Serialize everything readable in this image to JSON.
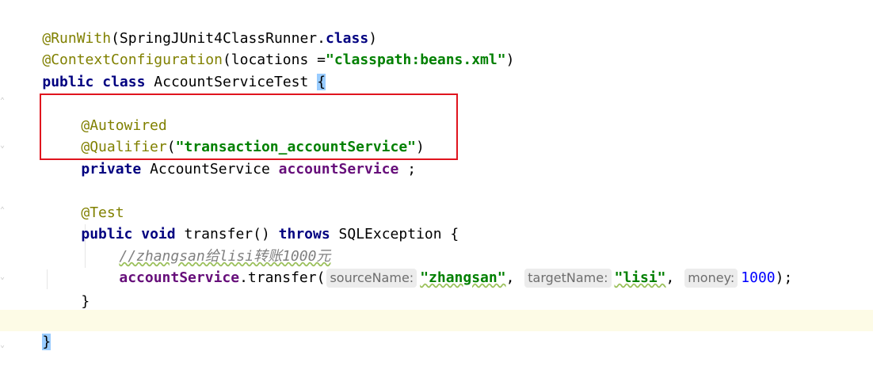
{
  "code": {
    "l1": {
      "ann": "@RunWith",
      "open": "(SpringJUnit4ClassRunner.",
      "kw": "class",
      "close": ")"
    },
    "l2": {
      "ann": "@ContextConfiguration",
      "open": "(locations =",
      "str": "\"classpath:beans.xml\"",
      "close": ")"
    },
    "l3": {
      "kw1": "public",
      "kw2": "class",
      "name": "AccountServiceTest",
      "brace": "{"
    },
    "l4": {
      "ann": "@Autowired"
    },
    "l5": {
      "ann": "@Qualifier",
      "open": "(",
      "str": "\"transaction_accountService\"",
      "close": ")"
    },
    "l6": {
      "kw": "private",
      "type": "AccountService",
      "field": "accountService",
      "end": ";"
    },
    "l7": {
      "ann": "@Test"
    },
    "l8": {
      "kw1": "public",
      "kw2": "void",
      "method": "transfer()",
      "kw3": "throws",
      "exc": "SQLException",
      "brace": "{"
    },
    "l9": {
      "comment": "//zhangsan给lisi转账1000元"
    },
    "l10": {
      "field": "accountService",
      "call": ".transfer(",
      "hint1": "sourceName:",
      "arg1": "\"zhangsan\"",
      "hint2": "targetName:",
      "arg2": "\"lisi\"",
      "hint3": "money:",
      "arg3": "1000",
      "end": ");"
    },
    "l11": {
      "brace": "}"
    },
    "l12": {
      "brace": "}"
    }
  },
  "colors": {
    "annotation": "#808000",
    "keyword": "#000080",
    "string": "#008000",
    "field": "#660e7a",
    "number": "#0000ff",
    "comment": "#808080",
    "highlight_box": "#e0141e",
    "current_line": "#fdfbe6"
  }
}
